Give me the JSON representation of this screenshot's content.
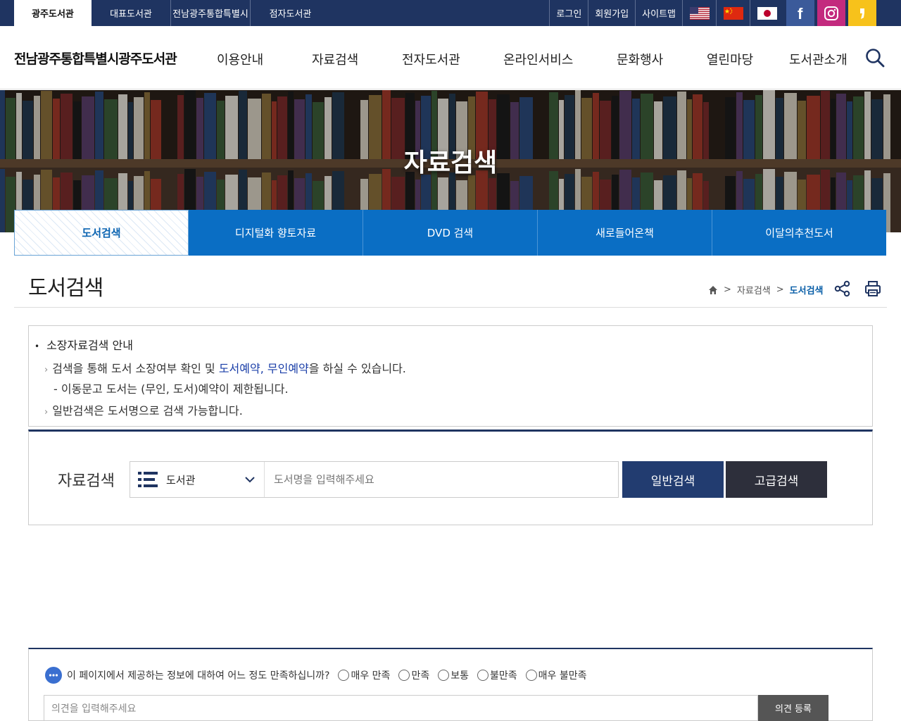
{
  "site_tabs": [
    "광주도서관",
    "대표도서관",
    "전남광주통합특별시",
    "점자도서관"
  ],
  "util_links": [
    "로그인",
    "회원가입",
    "사이트맵"
  ],
  "header": {
    "logo": "전남광주통합특별시광주도서관",
    "menu": [
      "이용안내",
      "자료검색",
      "전자도서관",
      "온라인서비스",
      "문화행사",
      "열린마당",
      "도서관소개"
    ]
  },
  "hero": {
    "title": "자료검색"
  },
  "subtabs": [
    "도서검색",
    "디지털화 향토자료",
    "DVD 검색",
    "새로들어온책",
    "이달의추천도서"
  ],
  "page": {
    "title": "도서검색",
    "breadcrumb": [
      "자료검색",
      "도서검색"
    ]
  },
  "info": {
    "heading": "소장자료검색 안내",
    "line1_pre": "검색을 통해 도서 소장여부 확인 및 ",
    "line1_hl1": "도서예약",
    "line1_mid": ", ",
    "line1_hl2": "무인예약",
    "line1_post": "을 하실 수 있습니다.",
    "line2": "- 이동문고 도서는 (무인, 도서)예약이 제한됩니다.",
    "line3": "일반검색은 도서명으로 검색 가능합니다."
  },
  "search": {
    "label": "자료검색",
    "select_value": "도서관",
    "placeholder": "도서명을 입력해주세요",
    "basic_button": "일반검색",
    "advanced_button": "고급검색"
  },
  "survey": {
    "question": "이 페이지에서 제공하는 정보에 대하여 어느 정도 만족하십니까?",
    "options": [
      "매우 만족",
      "만족",
      "보통",
      "불만족",
      "매우 불만족"
    ],
    "opinion_placeholder": "의견을 입력해주세요",
    "submit": "의견 등록"
  },
  "colors": {
    "navy": "#1f3461",
    "tab_blue": "#0a6ec4",
    "link_blue": "#1a3ea8",
    "kakao_yellow": "#f7c21b",
    "facebook": "#3b5a9a",
    "instagram": "#c32a7e"
  }
}
